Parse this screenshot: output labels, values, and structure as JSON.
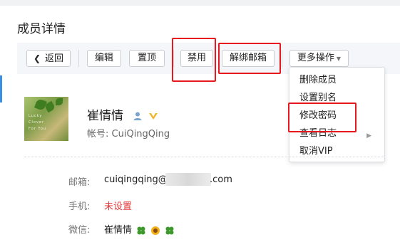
{
  "page": {
    "title": "成员详情"
  },
  "toolbar": {
    "back_label": "返回",
    "edit_label": "编辑",
    "pin_label": "置顶",
    "disable_label": "禁用",
    "unbind_email_label": "解绑邮箱",
    "more_label": "更多操作"
  },
  "more_menu": {
    "items": [
      {
        "label": "删除成员"
      },
      {
        "label": "设置别名"
      },
      {
        "label": "修改密码"
      },
      {
        "label": "查看日志"
      },
      {
        "label": "取消VIP"
      }
    ]
  },
  "member": {
    "name": "崔情情",
    "account_label": "帐号:",
    "account": "CuiQingQing",
    "avatar_text": [
      "Lucky",
      "Clover",
      "For You"
    ]
  },
  "details": {
    "email_label": "邮箱:",
    "email_prefix": "cuiqingqing@",
    "email_suffix": ".com",
    "phone_label": "手机:",
    "phone_value": "未设置",
    "wechat_label": "微信:",
    "wechat_value": "崔情情"
  },
  "colors": {
    "highlight_red": "#e8191e",
    "accent_blue": "#3a8fe0",
    "vip_gold": "#f0b429",
    "unset_red": "#e03a3a"
  },
  "icons": [
    "chevron-left-icon",
    "caret-down-icon",
    "user-icon",
    "vip-icon",
    "chevron-right-icon",
    "clover-icon",
    "sunflower-icon"
  ]
}
